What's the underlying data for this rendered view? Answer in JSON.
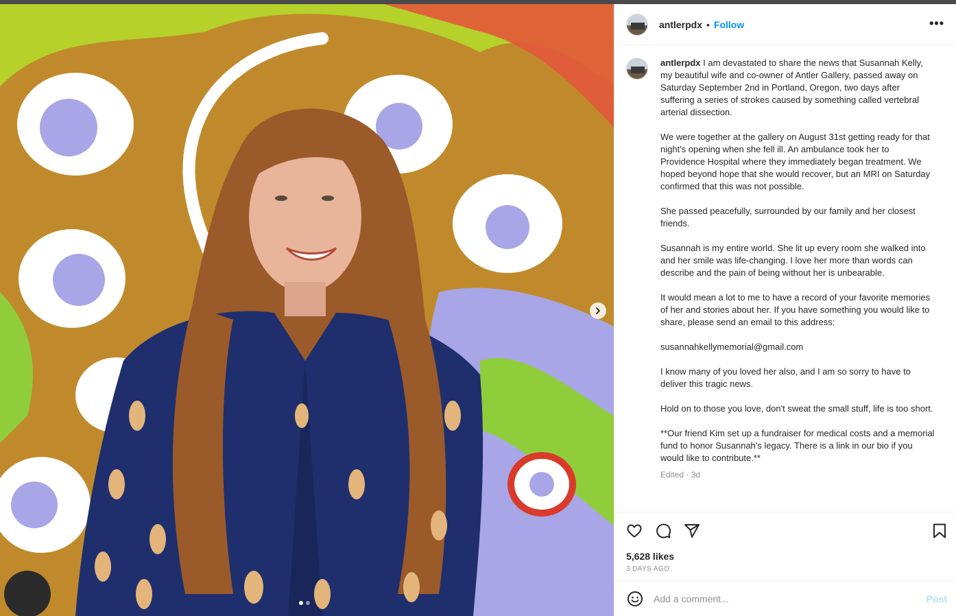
{
  "post": {
    "username": "antlerpdx",
    "separator": "•",
    "follow_label": "Follow",
    "more_label": "•••",
    "caption_paragraphs": [
      "I am devastated to share the news that Susannah Kelly, my beautiful wife and co-owner of Antler Gallery, passed away on Saturday September 2nd in Portland, Oregon, two days after suffering a series of strokes caused by something called vertebral arterial dissection.",
      "We were together at the gallery on August 31st getting ready for that night's opening when she fell ill. An ambulance took her to Providence Hospital where they immediately began treatment. We hoped beyond hope that she would recover, but an MRI on Saturday confirmed that this was not possible.",
      "She passed peacefully, surrounded by our family and her closest friends.",
      "Susannah is my entire world. She lit up every room she walked into and her smile was life-changing. I love her more than words can describe and the pain of being without her is unbearable.",
      "It would mean a lot to me to have a record of your favorite memories of her and stories about her. If you have something you would like to share, please send an email to this address:",
      "susannahkellymemorial@gmail.com",
      "I know many of you loved her also, and I am so sorry to have to deliver this tragic news.",
      "Hold on to those you love, don't sweat the small stuff, life is too short.",
      "**Our friend Kim set up a fundraiser for medical costs and a memorial fund to honor Susannah's legacy. There is a link in our bio if you would like to contribute.**"
    ],
    "caption_meta": "Edited · 3d",
    "likes": "5,628 likes",
    "date": "3 DAYS AGO",
    "comment_placeholder": "Add a comment...",
    "post_label": "Post"
  },
  "icons": {
    "like": "heart-icon",
    "comment": "comment-icon",
    "share": "share-icon",
    "save": "bookmark-icon",
    "emoji": "smiley-icon",
    "next": "chevron-right-icon"
  },
  "colors": {
    "accent": "#0095f6",
    "post_disabled": "#b2dffc",
    "muted": "#8e8e8e"
  },
  "carousel": {
    "slide_count": 2,
    "active_index": 0
  }
}
